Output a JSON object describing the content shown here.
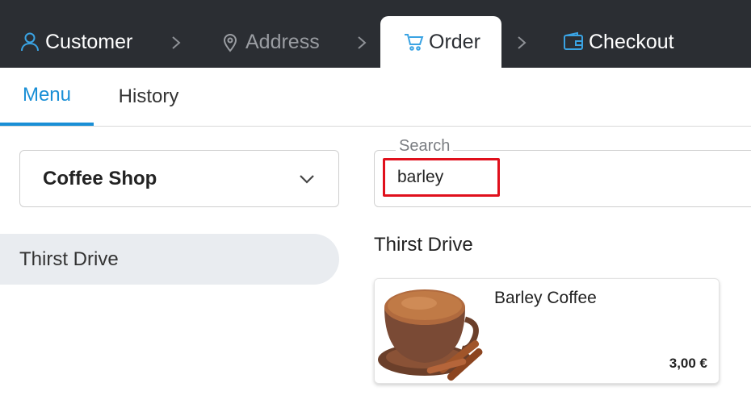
{
  "stepper": {
    "steps": [
      {
        "label": "Customer",
        "icon": "user-icon"
      },
      {
        "label": "Address",
        "icon": "map-pin-icon"
      },
      {
        "label": "Order",
        "icon": "cart-icon"
      },
      {
        "label": "Checkout",
        "icon": "wallet-icon"
      }
    ],
    "active": "Order"
  },
  "tabs": [
    {
      "label": "Menu",
      "active": true
    },
    {
      "label": "History",
      "active": false
    }
  ],
  "shop_select": {
    "value": "Coffee Shop"
  },
  "sidebar": {
    "categories": [
      {
        "label": "Thirst Drive"
      }
    ]
  },
  "search": {
    "label": "Search",
    "value": "barley"
  },
  "section": {
    "title": "Thirst Drive"
  },
  "products": [
    {
      "name": "Barley Coffee",
      "price": "3,00 €"
    }
  ],
  "colors": {
    "header_bg": "#2b2e33",
    "accent": "#1a8fd6",
    "highlight": "#e0101c"
  }
}
